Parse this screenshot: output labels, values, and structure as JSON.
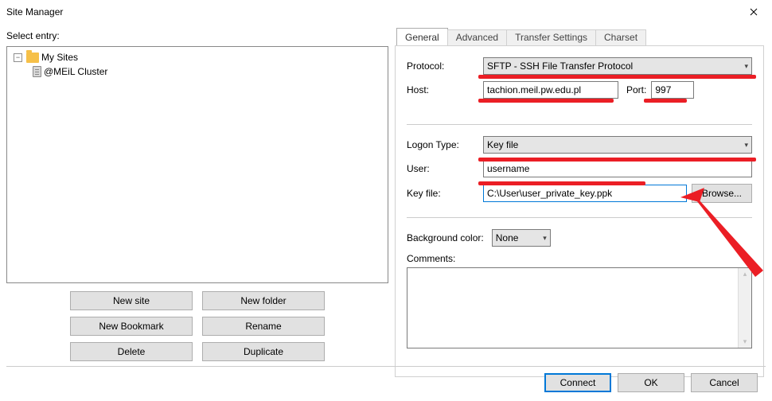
{
  "window": {
    "title": "Site Manager"
  },
  "left": {
    "select_entry": "Select entry:",
    "root_label": "My Sites",
    "site_label": "@MEiL Cluster",
    "buttons": {
      "new_site": "New site",
      "new_folder": "New folder",
      "new_bookmark": "New Bookmark",
      "rename": "Rename",
      "delete": "Delete",
      "duplicate": "Duplicate"
    }
  },
  "tabs": {
    "general": "General",
    "advanced": "Advanced",
    "transfer": "Transfer Settings",
    "charset": "Charset"
  },
  "fields": {
    "protocol_label": "Protocol:",
    "protocol_value": "SFTP - SSH File Transfer Protocol",
    "host_label": "Host:",
    "host_value": "tachion.meil.pw.edu.pl",
    "port_label": "Port:",
    "port_value": "997",
    "logon_label": "Logon Type:",
    "logon_value": "Key file",
    "user_label": "User:",
    "user_value": "username",
    "keyfile_label": "Key file:",
    "keyfile_value": "C:\\User\\user_private_key.ppk",
    "browse": "Browse...",
    "bg_label": "Background color:",
    "bg_value": "None",
    "comments_label": "Comments:"
  },
  "bottom": {
    "connect": "Connect",
    "ok": "OK",
    "cancel": "Cancel"
  }
}
